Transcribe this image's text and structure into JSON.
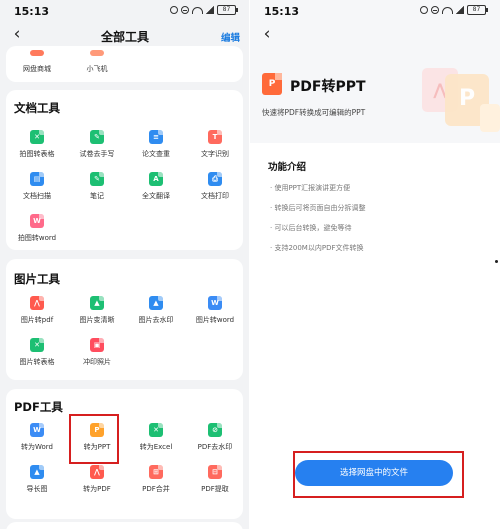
{
  "left_screen": {
    "status": {
      "time": "15:13",
      "battery": "87"
    },
    "header": {
      "title": "全部工具",
      "edit": "编辑"
    },
    "top_row": [
      {
        "label": "网盘商城",
        "icon": "store-icon"
      },
      {
        "label": "小飞机",
        "icon": "plane-icon"
      }
    ],
    "sections": [
      {
        "title": "文档工具",
        "items": [
          {
            "label": "拍图转表格",
            "icon": "excel-camera-icon",
            "color": "#1dbf73",
            "glyph": "✕"
          },
          {
            "label": "试卷去手写",
            "icon": "erase-handwriting-icon",
            "color": "#1dbf73",
            "glyph": "✎"
          },
          {
            "label": "论文查重",
            "icon": "paper-check-icon",
            "color": "#2f8cf0",
            "glyph": "≡"
          },
          {
            "label": "文字识别",
            "icon": "text-ocr-icon",
            "color": "#ff6a5e",
            "glyph": "T"
          },
          {
            "label": "文档扫描",
            "icon": "doc-scan-icon",
            "color": "#2f8cf0",
            "glyph": "▤"
          },
          {
            "label": "笔记",
            "icon": "notes-icon",
            "color": "#1dbf73",
            "glyph": "✎"
          },
          {
            "label": "全文翻译",
            "icon": "translate-icon",
            "color": "#1dbf73",
            "glyph": "A"
          },
          {
            "label": "文档打印",
            "icon": "print-icon",
            "color": "#2f8cf0",
            "glyph": "⎙"
          },
          {
            "label": "拍图转word",
            "icon": "word-camera-icon",
            "color": "#ff6a8a",
            "glyph": "W"
          }
        ]
      },
      {
        "title": "图片工具",
        "items": [
          {
            "label": "图片转pdf",
            "icon": "image-to-pdf-icon",
            "color": "#ff5a4e",
            "glyph": "⋀"
          },
          {
            "label": "图片变清晰",
            "icon": "image-enhance-icon",
            "color": "#1dbf73",
            "glyph": "▲"
          },
          {
            "label": "图片去水印",
            "icon": "remove-watermark-icon",
            "color": "#2f8cf0",
            "glyph": "▲"
          },
          {
            "label": "图片转word",
            "icon": "image-to-word-icon",
            "color": "#3b8cf5",
            "glyph": "W"
          },
          {
            "label": "图片转表格",
            "icon": "image-to-excel-icon",
            "color": "#1dbf73",
            "glyph": "✕"
          },
          {
            "label": "冲印照片",
            "icon": "photo-print-icon",
            "color": "#ff4d5e",
            "glyph": "▣"
          }
        ]
      },
      {
        "title": "PDF工具",
        "items": [
          {
            "label": "转为Word",
            "icon": "pdf-to-word-icon",
            "color": "#3b8cf5",
            "glyph": "W"
          },
          {
            "label": "转为PPT",
            "icon": "pdf-to-ppt-icon",
            "color": "#ffa22b",
            "glyph": "P"
          },
          {
            "label": "转为Excel",
            "icon": "pdf-to-excel-icon",
            "color": "#1dbf73",
            "glyph": "✕"
          },
          {
            "label": "PDF去水印",
            "icon": "pdf-remove-watermark-icon",
            "color": "#1dbf73",
            "glyph": "⊘"
          },
          {
            "label": "导长图",
            "icon": "export-long-image-icon",
            "color": "#2f8cf0",
            "glyph": "▲"
          },
          {
            "label": "转为PDF",
            "icon": "to-pdf-icon",
            "color": "#ff5a4e",
            "glyph": "⋀"
          },
          {
            "label": "PDF合并",
            "icon": "pdf-merge-icon",
            "color": "#ff6a5e",
            "glyph": "⊞"
          },
          {
            "label": "PDF提取",
            "icon": "pdf-extract-icon",
            "color": "#ff6a5e",
            "glyph": "⊟"
          }
        ]
      }
    ]
  },
  "right_screen": {
    "status": {
      "time": "15:13",
      "battery": "87"
    },
    "hero": {
      "title": "PDF转PPT",
      "subtitle": "快速将PDF转换成可编辑的PPT",
      "logo_glyph": "P"
    },
    "features": {
      "title": "功能介绍",
      "items": [
        "· 使用PPT汇报演讲更方便",
        "· 转换后可将页面自由分拆调整",
        "· 可以后台转换，避免等待",
        "· 支持200M以内PDF文件转换"
      ]
    },
    "action_button": "选择网盘中的文件"
  },
  "colors": {
    "accent": "#2680f0",
    "highlight": "#d61f1f",
    "edit_link": "#1e7de0"
  }
}
